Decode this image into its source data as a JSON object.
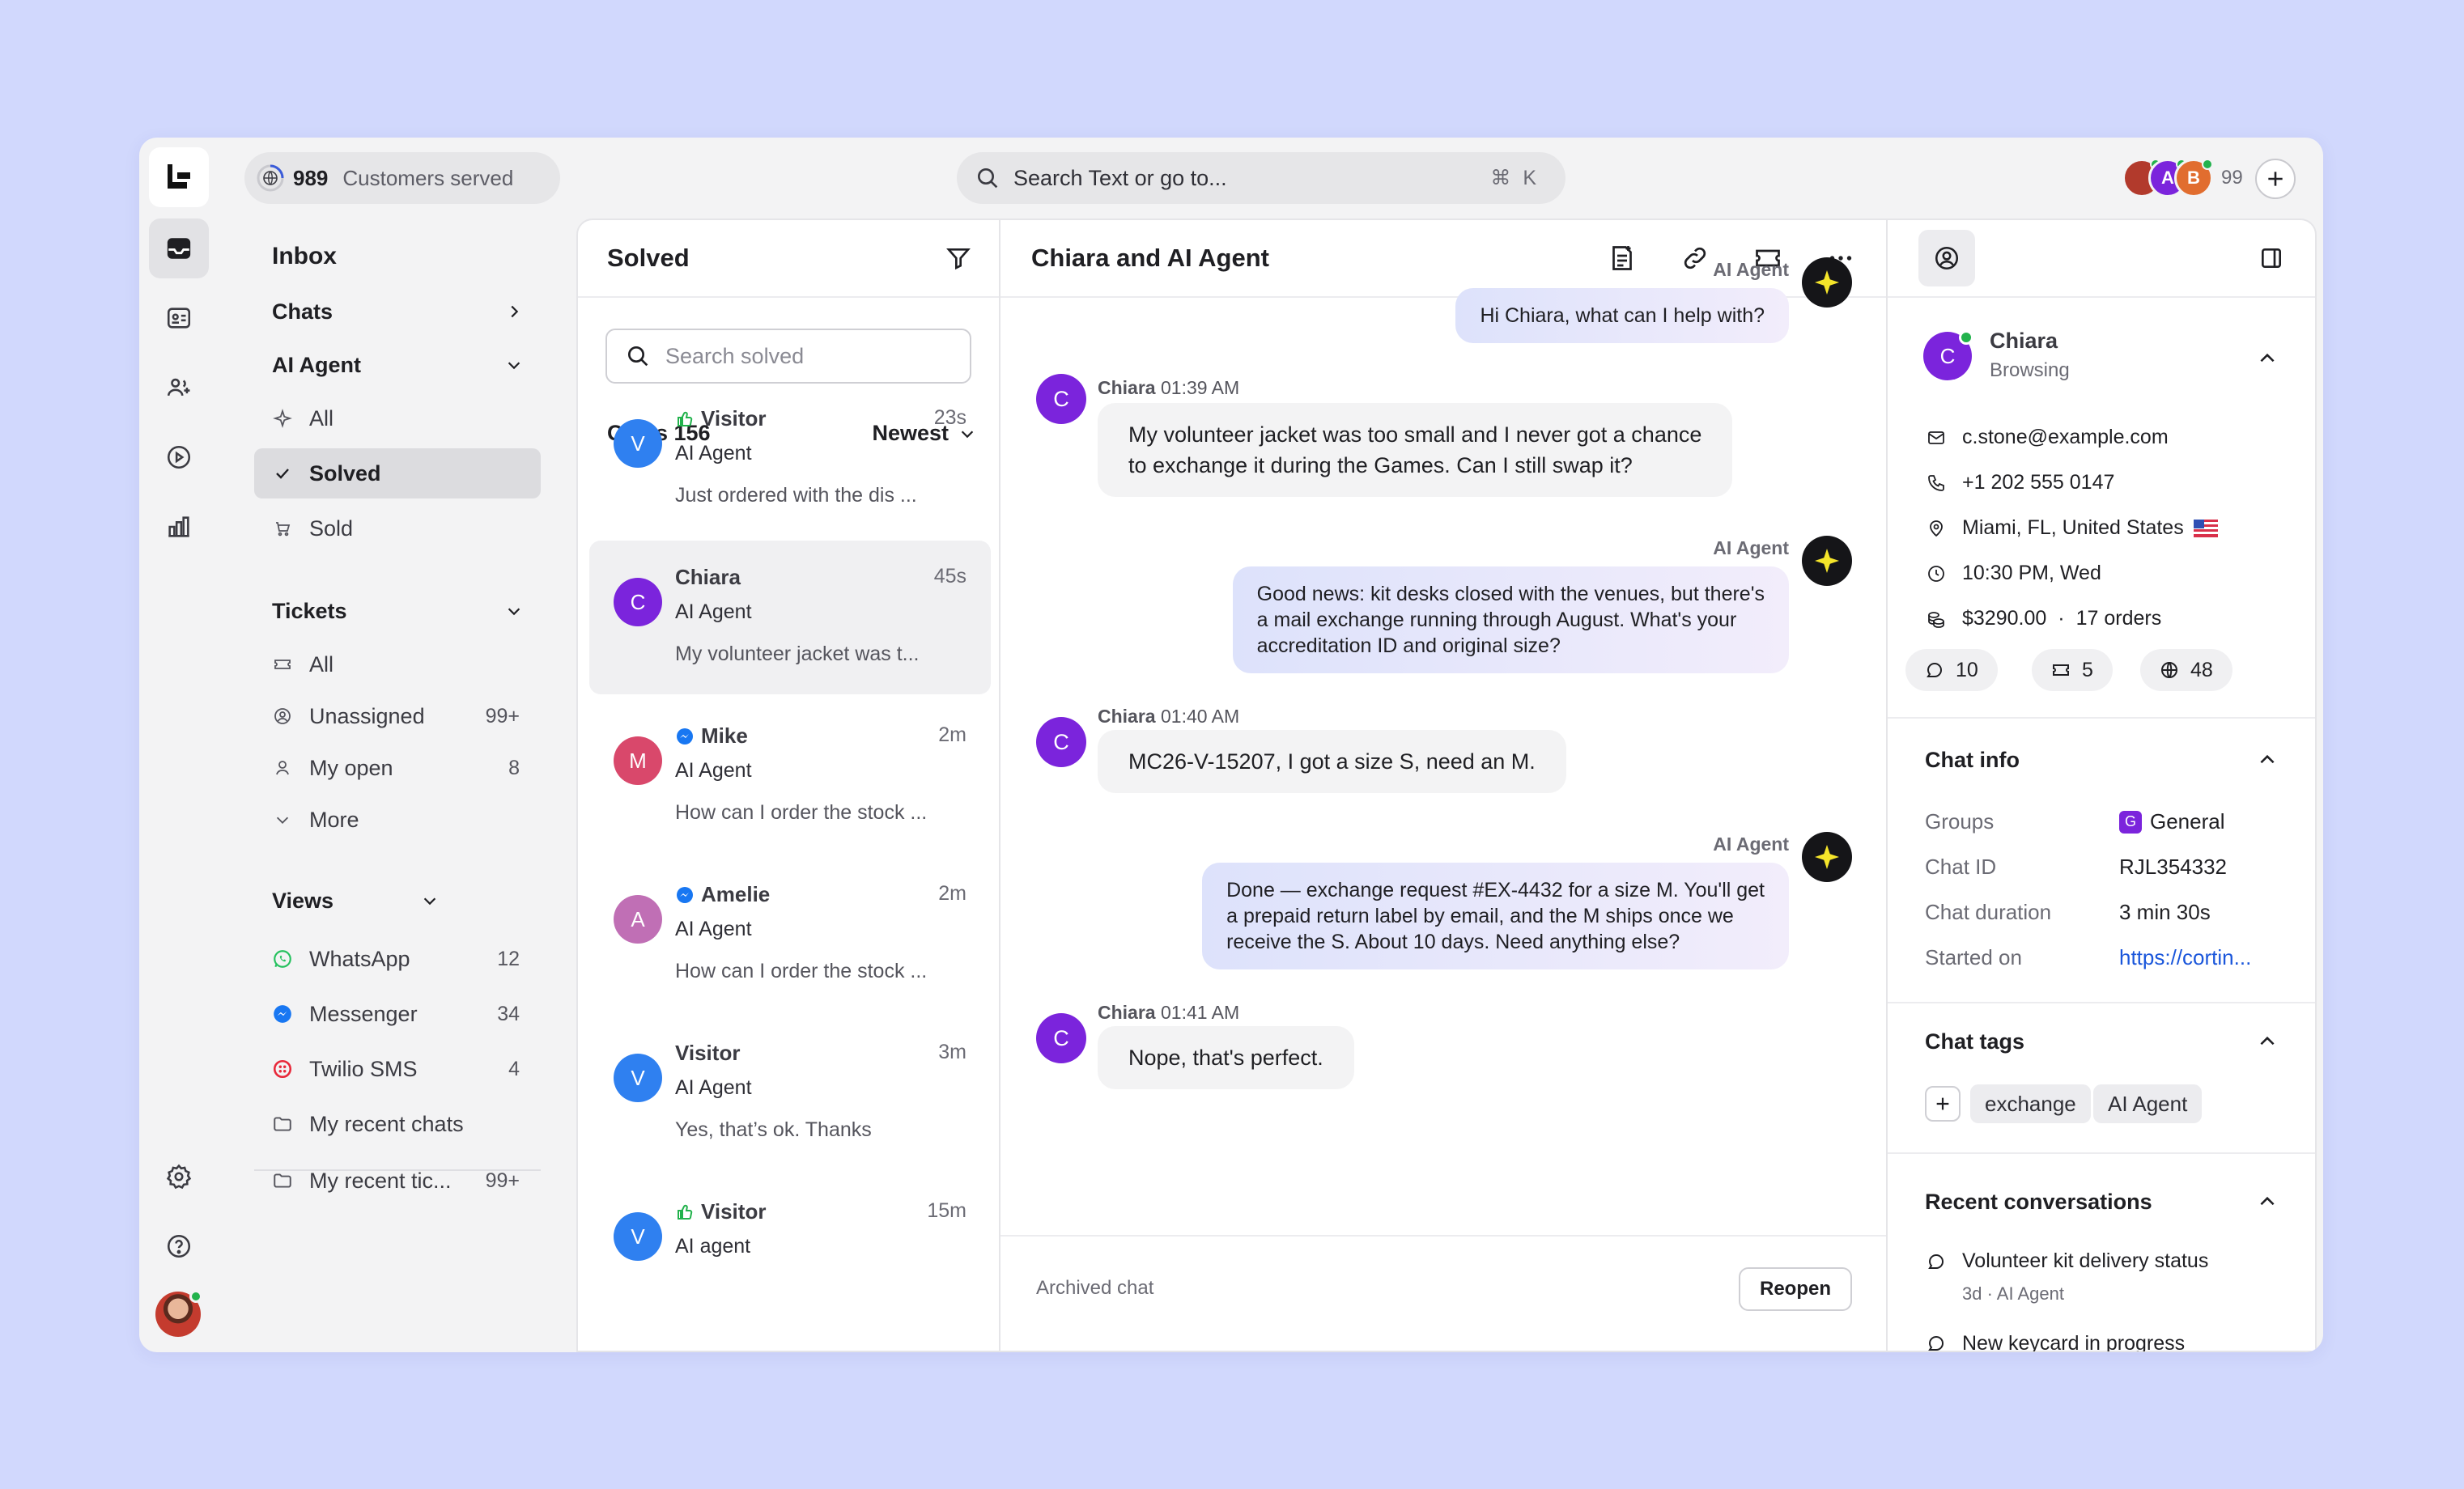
{
  "topbar": {
    "customers_count": "989",
    "customers_label": "Customers served",
    "search_placeholder": "Search Text or go to...",
    "shortcut": "⌘ K",
    "avatars": [
      {
        "initial": "",
        "color": "#b23a2c"
      },
      {
        "initial": "A",
        "color": "#7b24dc"
      },
      {
        "initial": "B",
        "color": "#e16d2f"
      }
    ],
    "avatar_count": "99"
  },
  "nav": {
    "title": "Inbox",
    "chats": "Chats",
    "ai_agent": "AI Agent",
    "ai_items": [
      {
        "label": "All",
        "icon": "sparkle-icon"
      },
      {
        "label": "Solved",
        "icon": "check-icon"
      },
      {
        "label": "Sold",
        "icon": "cart-icon"
      }
    ],
    "tickets": "Tickets",
    "ticket_items": [
      {
        "label": "All",
        "icon": "ticket-icon",
        "count": ""
      },
      {
        "label": "Unassigned",
        "icon": "user-circle-icon",
        "count": "99+"
      },
      {
        "label": "My open",
        "icon": "user-icon",
        "count": "8"
      },
      {
        "label": "More",
        "icon": "chevron-down-icon",
        "count": ""
      }
    ],
    "views": "Views",
    "view_items": [
      {
        "label": "WhatsApp",
        "count": "12"
      },
      {
        "label": "Messenger",
        "count": "34"
      },
      {
        "label": "Twilio SMS",
        "count": "4"
      },
      {
        "label": "My recent chats",
        "count": ""
      },
      {
        "label": "My recent tic...",
        "count": "99+"
      }
    ]
  },
  "list": {
    "title": "Solved",
    "search_placeholder": "Search solved",
    "chats_label": "Chats 156",
    "sort": "Newest",
    "items": [
      {
        "initial": "V",
        "color": "#2f80f0",
        "name": "Visitor",
        "channel": "thumb",
        "time": "23s",
        "agent": "AI Agent",
        "preview": "Just ordered with the dis ..."
      },
      {
        "initial": "C",
        "color": "#7b24dc",
        "name": "Chiara",
        "channel": "",
        "time": "45s",
        "agent": "AI Agent",
        "preview": "My volunteer jacket was t..."
      },
      {
        "initial": "M",
        "color": "#d9486b",
        "name": "Mike",
        "channel": "messenger",
        "time": "2m",
        "agent": "AI Agent",
        "preview": "How can I order the stock ..."
      },
      {
        "initial": "A",
        "color": "#c06fb5",
        "name": "Amelie",
        "channel": "messenger",
        "time": "2m",
        "agent": "AI Agent",
        "preview": "How can I order the stock ..."
      },
      {
        "initial": "V",
        "color": "#2f80f0",
        "name": "Visitor",
        "channel": "",
        "time": "3m",
        "agent": "AI Agent",
        "preview": "Yes, that’s ok. Thanks"
      },
      {
        "initial": "V",
        "color": "#2f80f0",
        "name": "Visitor",
        "channel": "thumb",
        "time": "15m",
        "agent": "AI agent",
        "preview": ""
      }
    ]
  },
  "chat": {
    "title": "Chiara and AI Agent",
    "ai_label": "AI Agent",
    "user_initial": "C",
    "messages": [
      {
        "from": "ai",
        "text": "Hi Chiara, what can I help with?"
      },
      {
        "from": "user",
        "name": "Chiara",
        "time": "01:39 AM",
        "lines": [
          "My volunteer jacket was too small and I never got a chance",
          "to exchange it during the Games. Can I still swap it?"
        ]
      },
      {
        "from": "ai",
        "lines": [
          "Good news: kit desks closed with the venues, but there's",
          "a mail exchange running through August. What's your",
          "accreditation ID and original size?"
        ]
      },
      {
        "from": "user",
        "name": "Chiara",
        "time": "01:40 AM",
        "lines": [
          "MC26-V-15207, I got a size S, need an M."
        ]
      },
      {
        "from": "ai",
        "lines": [
          "Done — exchange request #EX-4432 for a size M. You'll get",
          "a prepaid return label by email, and the M ships once we",
          "receive the S. About 10 days. Need anything else?"
        ]
      },
      {
        "from": "user",
        "name": "Chiara",
        "time": "01:41 AM",
        "lines": [
          "Nope, that's perfect."
        ]
      }
    ],
    "archived": "Archived chat",
    "reopen": "Reopen"
  },
  "customer": {
    "initial": "C",
    "name": "Chiara",
    "status": "Browsing",
    "email": "c.stone@example.com",
    "phone": "+1 202 555 0147",
    "location": "Miami, FL, United States",
    "local_time": "10:30 PM, Wed",
    "spend": "$3290.00",
    "orders": "17 orders",
    "stats": {
      "chats": "10",
      "tickets": "5",
      "visits": "48"
    }
  },
  "chat_info": {
    "title": "Chat info",
    "rows": [
      {
        "k": "Groups",
        "v": "General"
      },
      {
        "k": "Chat ID",
        "v": "RJL354332"
      },
      {
        "k": "Chat duration",
        "v": "3 min 30s"
      },
      {
        "k": "Started on",
        "v": "https://cortin..."
      }
    ],
    "group_badge": "G"
  },
  "chat_tags": {
    "title": "Chat tags",
    "tags": [
      "exchange",
      "AI Agent"
    ]
  },
  "recent": {
    "title": "Recent conversations",
    "items": [
      {
        "title": "Volunteer kit delivery status",
        "meta": "3d · AI Agent"
      },
      {
        "title": "New keycard in progress",
        "meta": ""
      }
    ]
  },
  "colors": {
    "accent": "#7b24dc",
    "online": "#22b24c",
    "link": "#1a56db",
    "ai_star": "#f5e52a"
  }
}
